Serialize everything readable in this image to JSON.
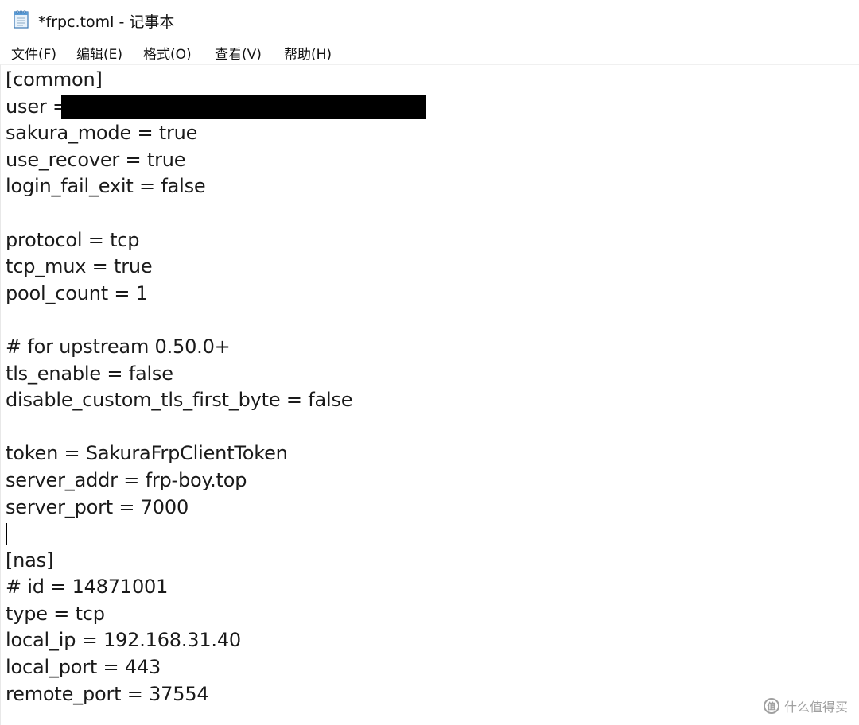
{
  "window": {
    "title": "*frpc.toml - 记事本",
    "app_icon": "notepad-icon"
  },
  "menu": [
    {
      "label": "文件(F)"
    },
    {
      "label": "编辑(E)"
    },
    {
      "label": "格式(O)"
    },
    {
      "label": "查看(V)"
    },
    {
      "label": "帮助(H)"
    }
  ],
  "editor": {
    "lines": [
      "[common]",
      "user = ",
      "sakura_mode = true",
      "use_recover = true",
      "login_fail_exit = false",
      "",
      "protocol = tcp",
      "tcp_mux = true",
      "pool_count = 1",
      "",
      "# for upstream 0.50.0+",
      "tls_enable = false",
      "disable_custom_tls_first_byte = false",
      "",
      "token = SakuraFrpClientToken",
      "server_addr = frp-boy.top",
      "server_port = 7000",
      "",
      "[nas]",
      "# id = 14871001",
      "type = tcp",
      "local_ip = 192.168.31.40",
      "local_port = 443",
      "remote_port = 37554"
    ],
    "redacted_line_index": 1,
    "caret_line_index": 17
  },
  "watermark": {
    "text": "什么值得买",
    "icon": "smzdm-logo-icon"
  }
}
